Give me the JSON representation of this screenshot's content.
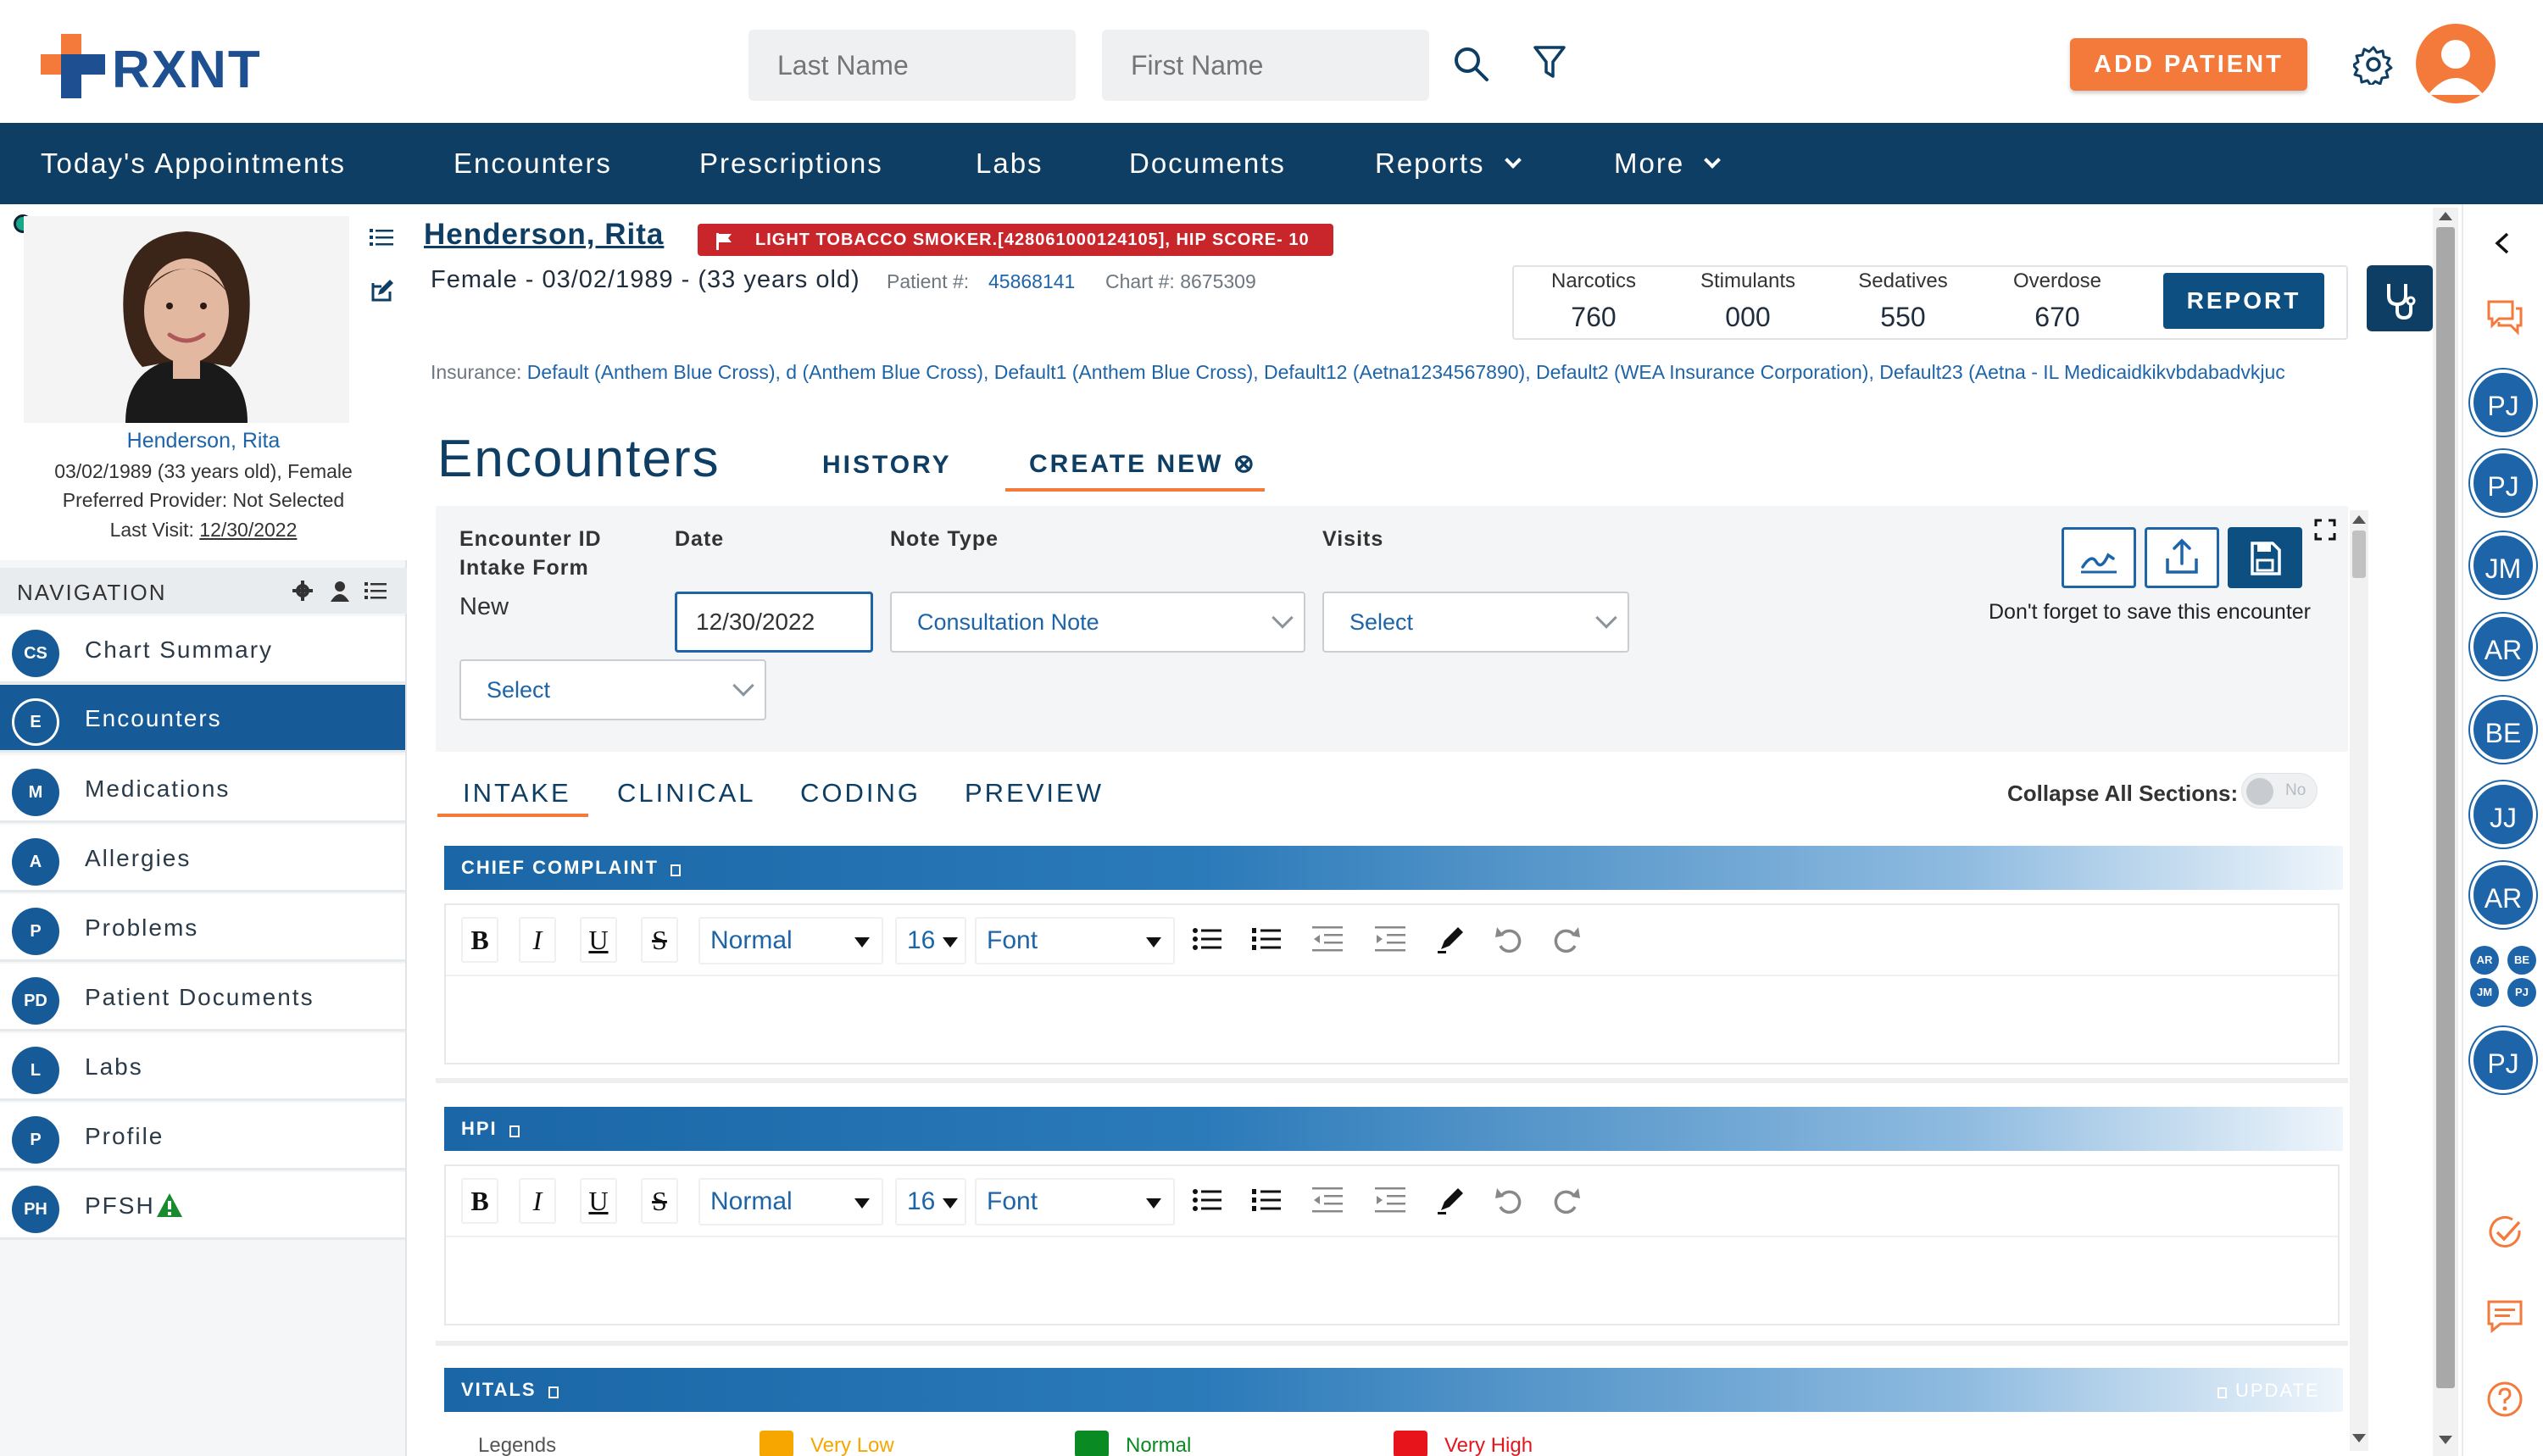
{
  "header": {
    "logo_text": "RXNT",
    "last_name_placeholder": "Last Name",
    "first_name_placeholder": "First Name",
    "add_patient_label": "ADD PATIENT"
  },
  "main_nav": [
    {
      "label": "Today's Appointments"
    },
    {
      "label": "Encounters"
    },
    {
      "label": "Prescriptions"
    },
    {
      "label": "Labs"
    },
    {
      "label": "Documents"
    },
    {
      "label": "Reports"
    },
    {
      "label": "More"
    }
  ],
  "patient_card": {
    "name": "Henderson, Rita",
    "dob_line": "03/02/1989 (33 years old), Female",
    "provider_line": "Preferred Provider: Not Selected",
    "last_visit_label": "Last Visit:",
    "last_visit_date": "12/30/2022"
  },
  "navigation": {
    "title": "NAVIGATION",
    "items": [
      {
        "abbr": "CS",
        "label": "Chart Summary"
      },
      {
        "abbr": "E",
        "label": "Encounters"
      },
      {
        "abbr": "M",
        "label": "Medications"
      },
      {
        "abbr": "A",
        "label": "Allergies"
      },
      {
        "abbr": "P",
        "label": "Problems"
      },
      {
        "abbr": "PD",
        "label": "Patient Documents"
      },
      {
        "abbr": "L",
        "label": "Labs"
      },
      {
        "abbr": "P",
        "label": "Profile"
      },
      {
        "abbr": "PH",
        "label": "PFSH"
      }
    ]
  },
  "patient_header": {
    "name": "Henderson, Rita",
    "alert": "LIGHT TOBACCO SMOKER.[428061000124105], HIP SCORE- 10",
    "demographics": "Female - 03/02/1989 - (33 years old)",
    "patient_num_label": "Patient #:",
    "patient_num": "45868141",
    "chart_num": "Chart #: 8675309",
    "insurance_label": "Insurance:",
    "insurance_value": "Default (Anthem Blue Cross), d (Anthem Blue Cross), Default1 (Anthem Blue Cross), Default12 (Aetna1234567890), Default2 (WEA Insurance Corporation), Default23 (Aetna - IL Medicaidkikvbdabadvkjuc"
  },
  "pdmp": {
    "items": [
      {
        "label": "Narcotics",
        "value": "760"
      },
      {
        "label": "Stimulants",
        "value": "000"
      },
      {
        "label": "Sedatives",
        "value": "550"
      },
      {
        "label": "Overdose",
        "value": "670"
      }
    ],
    "report_label": "REPORT"
  },
  "encounters": {
    "title": "Encounters",
    "tab_history": "HISTORY",
    "tab_create": "CREATE NEW ⊗",
    "form": {
      "encounter_id_label": "Encounter ID",
      "intake_form_label": "Intake Form",
      "encounter_id_value": "New",
      "date_label": "Date",
      "date_value": "12/30/2022",
      "note_type_label": "Note Type",
      "note_type_value": "Consultation Note",
      "visits_label": "Visits",
      "visits_value": "Select",
      "intake_form_value": "Select",
      "save_reminder": "Don't forget to save this encounter"
    },
    "subtabs": [
      {
        "label": "INTAKE"
      },
      {
        "label": "CLINICAL"
      },
      {
        "label": "CODING"
      },
      {
        "label": "PREVIEW"
      }
    ],
    "collapse_label": "Collapse All Sections:",
    "collapse_value": "No",
    "sections": {
      "chief_complaint": "CHIEF COMPLAINT",
      "hpi": "HPI",
      "vitals": "VITALS",
      "update_label": "UPDATE"
    },
    "toolbar": {
      "style_value": "Normal",
      "size_value": "16",
      "font_value": "Font",
      "bold": "B",
      "italic": "I",
      "underline": "U",
      "strike": "S"
    },
    "legends": {
      "label": "Legends",
      "items": [
        {
          "label": "Very Low",
          "color": "#f7a600"
        },
        {
          "label": "Normal",
          "color": "#0a8a22"
        },
        {
          "label": "Very High",
          "color": "#e8141c"
        }
      ]
    }
  },
  "right_rail": {
    "avatars": [
      "PJ",
      "PJ",
      "JM",
      "AR",
      "BE",
      "JJ",
      "AR"
    ],
    "mini_avatars": [
      "AR",
      "BE",
      "JM",
      "PJ"
    ],
    "last_avatar": "PJ"
  },
  "colors": {
    "brand_navy": "#0e3e63",
    "brand_orange": "#f47a3c",
    "accent_blue": "#1d64a8",
    "alert_red": "#c9262c"
  }
}
